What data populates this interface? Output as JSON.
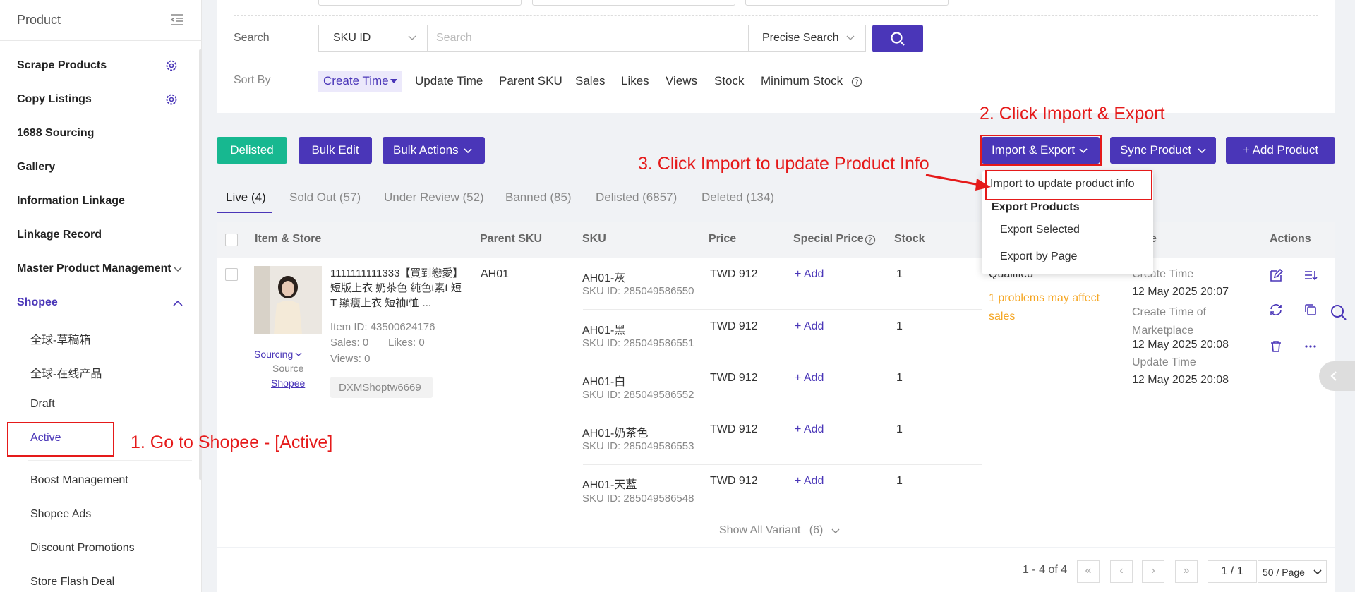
{
  "sidebar": {
    "title": "Product",
    "items": [
      {
        "label": "Scrape Products",
        "gear": true
      },
      {
        "label": "Copy Listings",
        "gear": true
      },
      {
        "label": "1688 Sourcing"
      },
      {
        "label": "Gallery"
      },
      {
        "label": "Information Linkage"
      },
      {
        "label": "Linkage Record"
      },
      {
        "label": "Master Product Management"
      },
      {
        "label": "Shopee"
      }
    ],
    "shopee_sub": [
      "全球-草稿箱",
      "全球-在线产品",
      "Draft",
      "Active",
      "Boost Management",
      "Shopee Ads",
      "Discount Promotions",
      "Store Flash Deal"
    ]
  },
  "search": {
    "label": "Search",
    "type": "SKU ID",
    "placeholder": "Search",
    "mode": "Precise Search"
  },
  "sort": {
    "label": "Sort By",
    "active": "Create Time",
    "options": [
      "Update Time",
      "Parent SKU",
      "Sales",
      "Likes",
      "Views",
      "Stock",
      "Minimum Stock"
    ]
  },
  "toolbar": {
    "delisted": "Delisted",
    "bulk_edit": "Bulk Edit",
    "bulk_actions": "Bulk Actions",
    "import_export": "Import & Export",
    "sync_product": "Sync Product",
    "add_product": "+ Add Product"
  },
  "dropdown": {
    "import": "Import to update product info",
    "export_header": "Export Products",
    "export_selected": "Export Selected",
    "export_page": "Export by Page"
  },
  "tabs": [
    "Live (4)",
    "Sold Out (57)",
    "Under Review (52)",
    "Banned (85)",
    "Delisted (6857)",
    "Deleted (134)"
  ],
  "table": {
    "headers": {
      "item": "Item & Store",
      "parent_sku": "Parent SKU",
      "sku": "SKU",
      "price": "Price",
      "special_price": "Special Price",
      "stock": "Stock",
      "time": "e",
      "actions": "Actions"
    },
    "product": {
      "title": "1111111111333【買到戀愛】短版上衣 奶茶色 純色t素t 短T 顯瘦上衣 短袖t恤 ...",
      "item_id": "Item ID: 43500624176",
      "sales": "Sales: 0",
      "likes": "Likes: 0",
      "views": "Views: 0",
      "store": "DXMShoptw6669",
      "sourcing": "Sourcing",
      "source": "Source",
      "source_link": "Shopee",
      "parent_sku": "AH01"
    },
    "variants": [
      {
        "sku": "AH01-灰",
        "sku_id": "SKU ID: 285049586550",
        "price": "TWD 912",
        "special": "+ Add",
        "stock": "1"
      },
      {
        "sku": "AH01-黑",
        "sku_id": "SKU ID: 285049586551",
        "price": "TWD 912",
        "special": "+ Add",
        "stock": "1"
      },
      {
        "sku": "AH01-白",
        "sku_id": "SKU ID: 285049586552",
        "price": "TWD 912",
        "special": "+ Add",
        "stock": "1"
      },
      {
        "sku": "AH01-奶茶色",
        "sku_id": "SKU ID: 285049586553",
        "price": "TWD 912",
        "special": "+ Add",
        "stock": "1"
      },
      {
        "sku": "AH01-天藍",
        "sku_id": "SKU ID: 285049586548",
        "price": "TWD 912",
        "special": "+ Add",
        "stock": "1"
      }
    ],
    "show_all": "Show All Variant",
    "show_all_count": "(6)",
    "status": "Qualified",
    "warning": "1 problems may affect sales",
    "times": {
      "create_label": "Create Time",
      "create_val": "12 May 2025 20:07",
      "market_label": "Create Time of Marketplace",
      "market_val": "12 May 2025 20:08",
      "update_label": "Update Time",
      "update_val": "12 May 2025 20:08"
    }
  },
  "pagination": {
    "summary": "1 - 4 of 4",
    "page": "1 / 1",
    "per_page": "50 / Page"
  },
  "annotations": {
    "step1": "1. Go to Shopee - [Active]",
    "step2": "2. Click Import & Export",
    "step3": "3. Click Import to update Product Info"
  },
  "colors": {
    "accent": "#4a36b8",
    "green": "#17b890",
    "annotation": "#e51a1a",
    "warning": "#f5a623"
  }
}
